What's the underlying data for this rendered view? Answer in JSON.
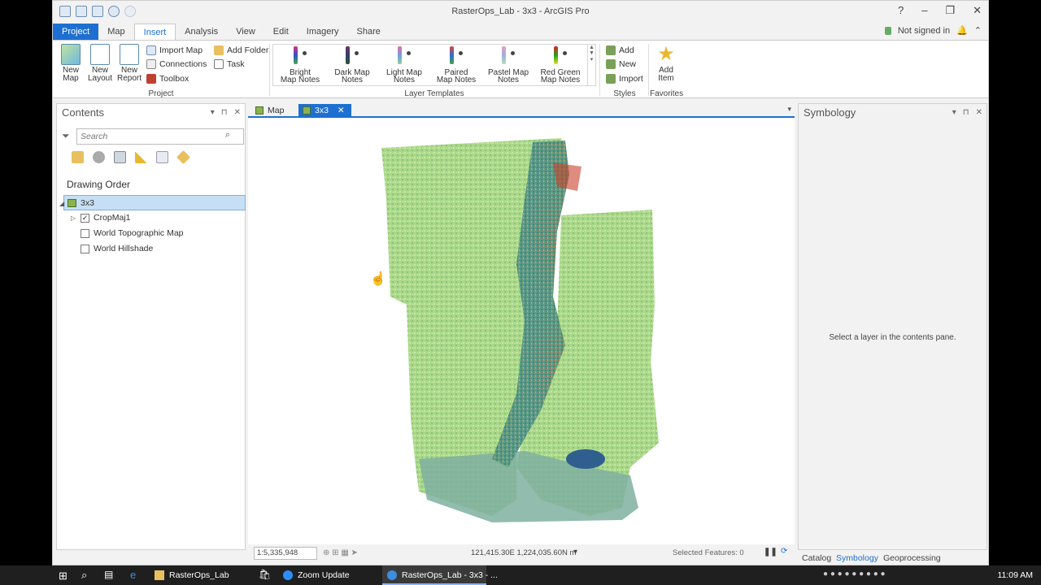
{
  "window": {
    "title": "RasterOps_Lab - 3x3 - ArcGIS Pro",
    "controls": [
      "?",
      "–",
      "❐",
      "✕"
    ]
  },
  "ribbon_tabs": [
    "Project",
    "Map",
    "Insert",
    "Analysis",
    "View",
    "Edit",
    "Imagery",
    "Share"
  ],
  "active_tab": "Insert",
  "signin": "Not signed in",
  "ribbon": {
    "project_group": {
      "label": "Project",
      "new_map": "New Map",
      "new_layout": "New Layout",
      "new_report": "New Report",
      "import_map": "Import Map",
      "connections": "Connections",
      "toolbox": "Toolbox",
      "add_folder": "Add Folder",
      "task": "Task"
    },
    "layer_templates": {
      "label": "Layer Templates",
      "items": [
        {
          "line1": "Bright",
          "line2": "Map Notes",
          "colors": [
            "#e0307a",
            "#3050d0",
            "#40b040"
          ]
        },
        {
          "line1": "Dark Map",
          "line2": "Notes",
          "colors": [
            "#703060",
            "#304070",
            "#305030"
          ]
        },
        {
          "line1": "Light Map",
          "line2": "Notes",
          "colors": [
            "#e070a0",
            "#70a0e0",
            "#90d090"
          ]
        },
        {
          "line1": "Paired",
          "line2": "Map Notes",
          "colors": [
            "#e04040",
            "#3070d0",
            "#40a040"
          ]
        },
        {
          "line1": "Pastel Map",
          "line2": "Notes",
          "colors": [
            "#e0a0c0",
            "#a0b0e0",
            "#b0e0b0"
          ]
        },
        {
          "line1": "Red Green",
          "line2": "Map Notes",
          "colors": [
            "#e02020",
            "#20a020",
            "#e0e020"
          ]
        }
      ]
    },
    "styles_group": {
      "label": "Styles",
      "add": "Add",
      "new": "New",
      "import": "Import"
    },
    "favorites_group": {
      "label": "Favorites",
      "add_item_line1": "Add",
      "add_item_line2": "Item"
    }
  },
  "contents": {
    "title": "Contents",
    "search_placeholder": "Search",
    "drawing_order": "Drawing Order",
    "layers": [
      {
        "name": "3x3",
        "checked": null,
        "selected": true
      },
      {
        "name": "CropMaj1",
        "checked": true,
        "selected": false
      },
      {
        "name": "World Topographic Map",
        "checked": false,
        "selected": false
      },
      {
        "name": "World Hillshade",
        "checked": false,
        "selected": false
      }
    ]
  },
  "map_tabs": [
    {
      "label": "Map",
      "active": false
    },
    {
      "label": "3x3",
      "active": true
    }
  ],
  "map_status": {
    "scale": "1:5,335,948",
    "coords": "121,415.30E 1,224,035.60N m",
    "selected_features": "Selected Features: 0"
  },
  "symbology": {
    "title": "Symbology",
    "message": "Select a layer in the contents pane."
  },
  "bottom_tabs": [
    "Catalog",
    "Symbology",
    "Geoprocessing"
  ],
  "active_bottom_tab": "Symbology",
  "taskbar": {
    "items": [
      "RasterOps_Lab",
      "Zoom Update",
      "RasterOps_Lab - 3x3 - ..."
    ],
    "time": "11:09 AM"
  }
}
